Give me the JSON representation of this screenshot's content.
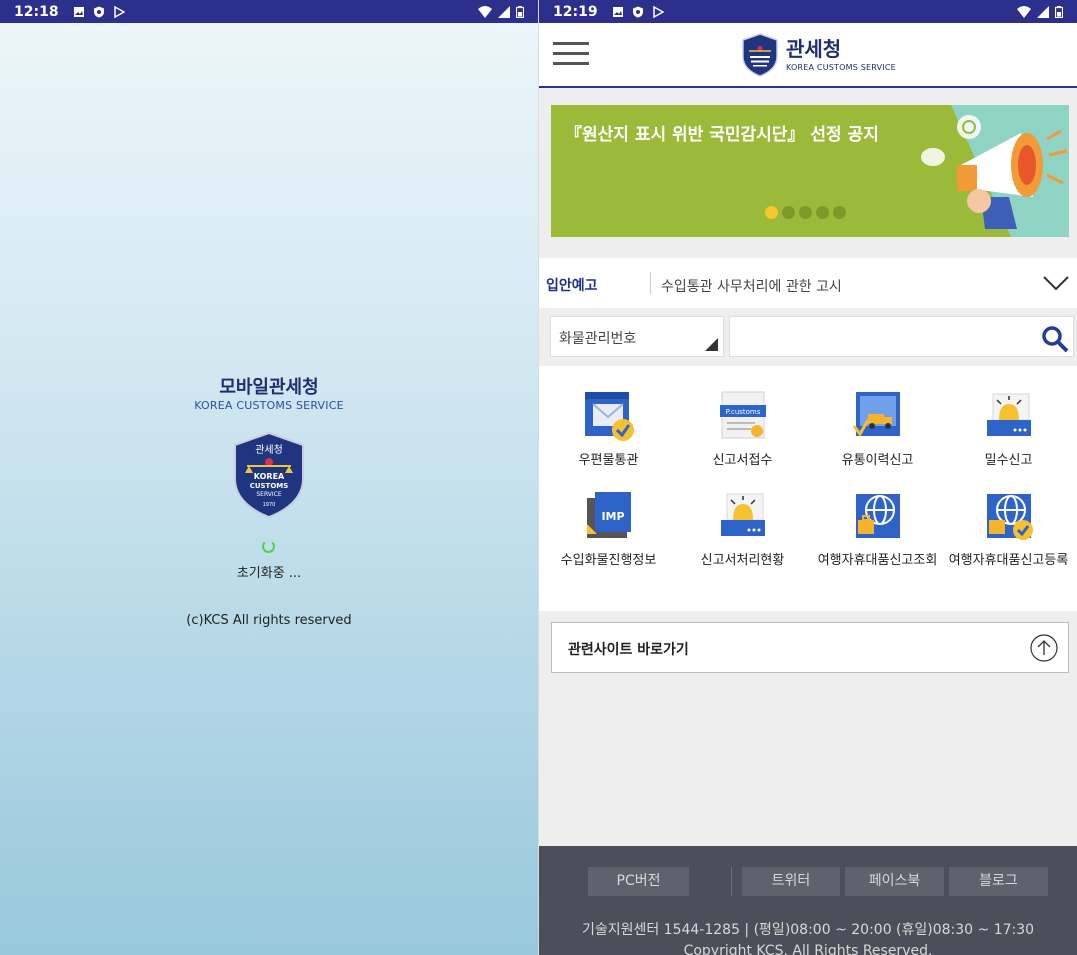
{
  "left": {
    "statusbar": {
      "time": "12:18"
    },
    "splash": {
      "title": "모바일관세청",
      "subtitle": "KOREA CUSTOMS SERVICE",
      "loading_text": "초기화중 ...",
      "rights": "(c)KCS All rights reserved"
    },
    "emblem": {
      "top": "관세청",
      "korea": "KOREA",
      "customs": "CUSTOMS",
      "service": "SERVICE",
      "year": "1970"
    }
  },
  "right": {
    "statusbar": {
      "time": "12:19"
    },
    "header": {
      "title": "관세청",
      "subtitle": "KOREA CUSTOMS SERVICE"
    },
    "banner": {
      "text": "『원산지 표시 위반 국민감시단』 선정 공지",
      "slide_count": 5,
      "active_slide": 1
    },
    "notice": {
      "label": "입안예고",
      "text": "수입통관 사무처리에 관한 고시"
    },
    "search": {
      "select_value": "화물관리번호",
      "input_value": ""
    },
    "menu": [
      {
        "label": "우편물통관",
        "icon": "mail-check-icon"
      },
      {
        "label": "신고서접수",
        "icon": "customs-document-icon"
      },
      {
        "label": "유통이력신고",
        "icon": "delivery-truck-icon"
      },
      {
        "label": "밀수신고",
        "icon": "alarm-report-icon"
      },
      {
        "label": "수입화물진행정보",
        "icon": "imp-cargo-icon"
      },
      {
        "label": "신고서처리현황",
        "icon": "alarm-status-icon"
      },
      {
        "label": "여행자휴대품신고조회",
        "icon": "globe-luggage-icon"
      },
      {
        "label": "여행자휴대품신고등록",
        "icon": "globe-luggage-check-icon"
      }
    ],
    "related": {
      "label": "관련사이트 바로가기"
    },
    "footer": {
      "pc_label": "PC버전",
      "twitter_label": "트위터",
      "facebook_label": "페이스북",
      "blog_label": "블로그",
      "info": "기술지원센터 1544-1285 | (평일)08:00 ~ 20:00 (휴일)08:30 ~ 17:30",
      "copyright": "Copyright KCS. All Rights Reserved."
    },
    "colors": {
      "brand": "#2c2f8c",
      "banner": "#9cba3a",
      "footer": "#4b4f59"
    }
  }
}
